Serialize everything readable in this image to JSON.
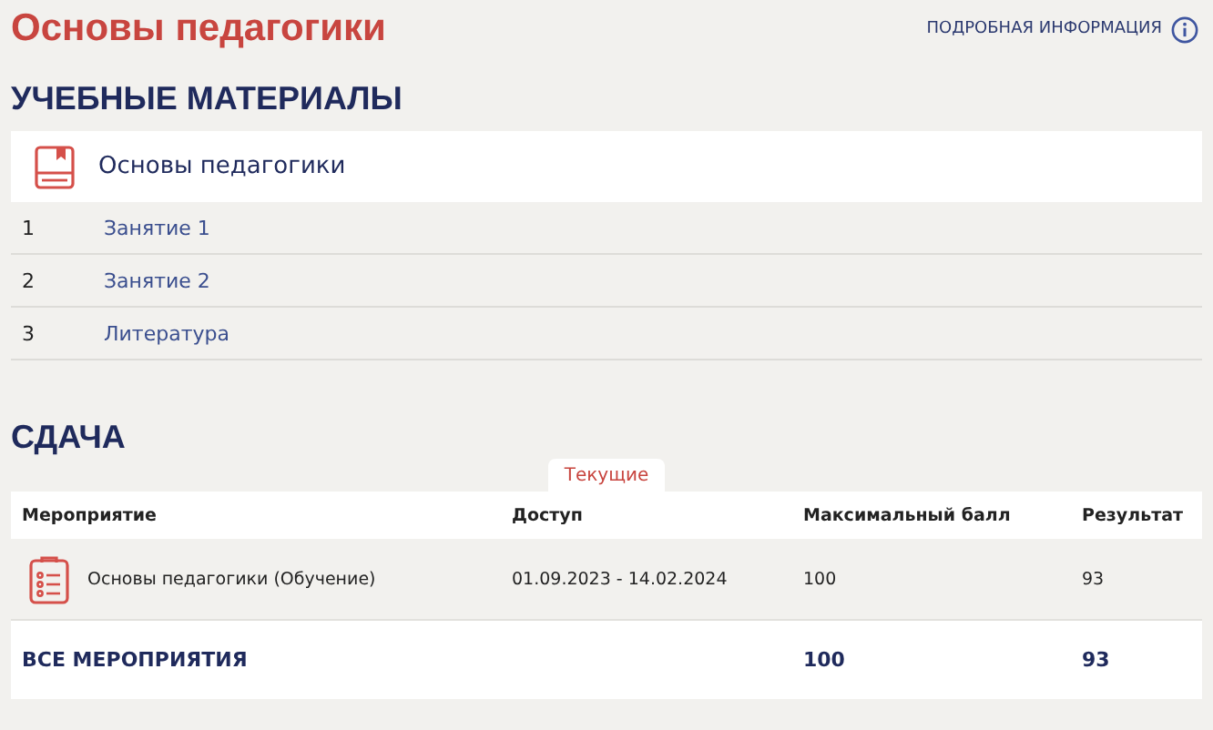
{
  "title": "Основы педагогики",
  "info_link": "ПОДРОБНАЯ ИНФОРМАЦИЯ",
  "materials": {
    "heading": "УЧЕБНЫЕ МАТЕРИАЛЫ",
    "course": "Основы педагогики",
    "items": [
      {
        "number": "1",
        "label": "Занятие 1"
      },
      {
        "number": "2",
        "label": "Занятие 2"
      },
      {
        "number": "3",
        "label": "Литература"
      }
    ]
  },
  "submission": {
    "heading": "СДАЧА",
    "tabs": [
      {
        "label": "Текущие",
        "selected": true
      }
    ],
    "table": {
      "columns": [
        "Мероприятие",
        "Доступ",
        "Максимальный балл",
        "Результат"
      ],
      "rows": [
        {
          "event": "Основы педагогики (Обучение)",
          "access": "01.09.2023 - 14.02.2024",
          "max_score": "100",
          "result": "93"
        }
      ],
      "total": {
        "label": "ВСЕ МЕРОПРИЯТИЯ",
        "max_score": "100",
        "result": "93"
      }
    }
  }
}
